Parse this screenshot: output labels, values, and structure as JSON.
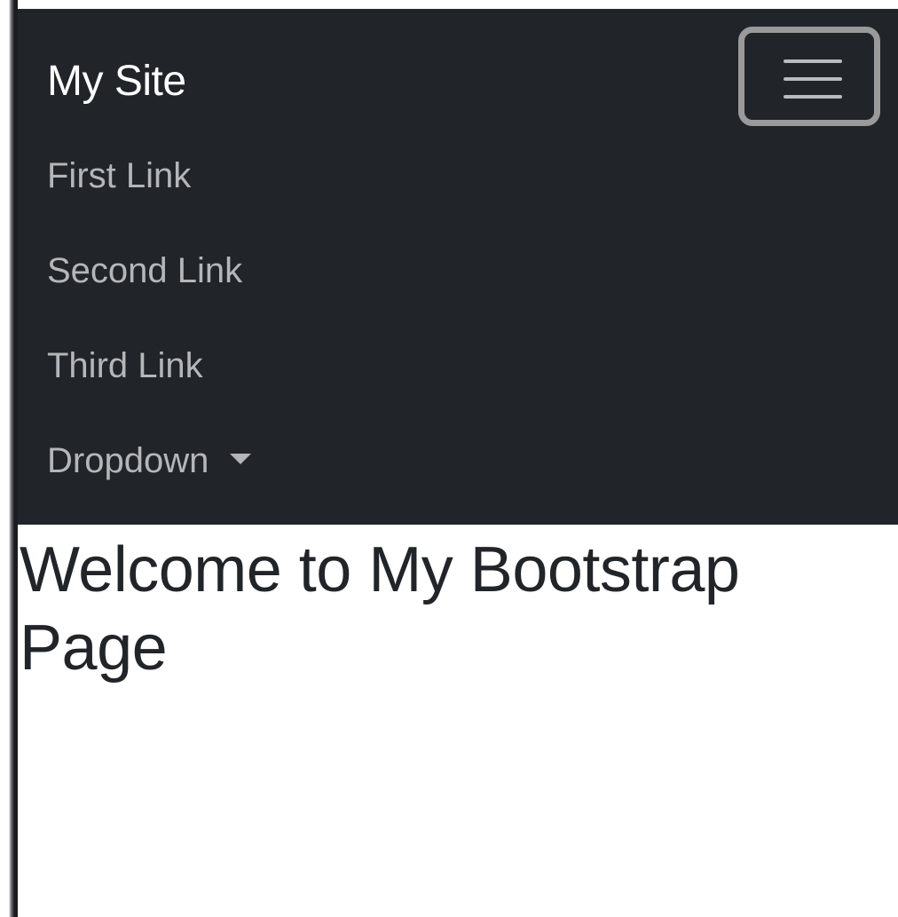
{
  "navbar": {
    "brand": "My Site",
    "toggler_icon": "hamburger-menu-icon",
    "links": [
      {
        "label": "First Link"
      },
      {
        "label": "Second Link"
      },
      {
        "label": "Third Link"
      },
      {
        "label": "Dropdown",
        "icon": "caret-down-icon"
      }
    ],
    "background_color": "#212529",
    "brand_color": "#ffffff",
    "link_color": "#b4b6b8"
  },
  "main": {
    "heading": "Welcome to My Bootstrap Page",
    "heading_color": "#212529"
  }
}
